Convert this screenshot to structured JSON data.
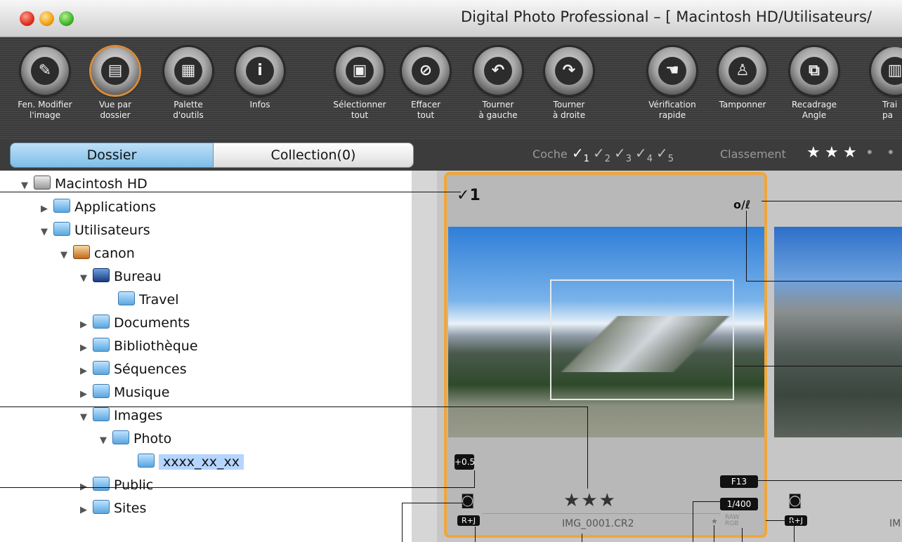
{
  "window": {
    "title": "Digital Photo Professional – [ Macintosh HD/Utilisateurs/"
  },
  "toolbar": {
    "buttons": [
      {
        "label": "Fen. Modifier\nl'image",
        "icon": "edit-window-icon"
      },
      {
        "label": "Vue par\ndossier",
        "icon": "folder-view-icon"
      },
      {
        "label": "Palette\nd'outils",
        "icon": "tool-palette-icon"
      },
      {
        "label": "Infos",
        "icon": "info-icon"
      },
      {
        "label": "Sélectionner\ntout",
        "icon": "select-all-icon"
      },
      {
        "label": "Effacer\ntout",
        "icon": "clear-all-icon"
      },
      {
        "label": "Tourner\nà gauche",
        "icon": "rotate-left-icon"
      },
      {
        "label": "Tourner\nà droite",
        "icon": "rotate-right-icon"
      },
      {
        "label": "Vérification\nrapide",
        "icon": "quick-check-icon"
      },
      {
        "label": "Tamponner",
        "icon": "stamp-icon"
      },
      {
        "label": "Recadrage\nAngle",
        "icon": "crop-angle-icon"
      },
      {
        "label": "Trai\npa",
        "icon": "batch-process-icon"
      }
    ]
  },
  "tabs": {
    "dossier": "Dossier",
    "collection": "Collection(0)"
  },
  "filters": {
    "coche_label": "Coche",
    "coches": [
      "1",
      "2",
      "3",
      "4",
      "5"
    ],
    "classement_label": "Classement"
  },
  "tree": {
    "items": [
      {
        "label": "Macintosh HD"
      },
      {
        "label": "Applications"
      },
      {
        "label": "Utilisateurs"
      },
      {
        "label": "canon"
      },
      {
        "label": "Bureau"
      },
      {
        "label": "Travel"
      },
      {
        "label": "Documents"
      },
      {
        "label": "Bibliothèque"
      },
      {
        "label": "Séquences"
      },
      {
        "label": "Musique"
      },
      {
        "label": "Images"
      },
      {
        "label": "Photo"
      },
      {
        "label": "xxxx_xx_xx"
      },
      {
        "label": "Public"
      },
      {
        "label": "Sites"
      }
    ]
  },
  "thumbnail1": {
    "check": "1",
    "exposure": "+0.5",
    "aperture": "F13",
    "shutter": "1/400",
    "rating": "★★★",
    "filename": "IMG_0001.CR2",
    "format_badge": "R+J",
    "raw": "RAW",
    "rgb": "RGB",
    "edit_mark": "o/ℓ"
  },
  "thumbnail2": {
    "format_badge": "R+J",
    "filename": "IM"
  }
}
